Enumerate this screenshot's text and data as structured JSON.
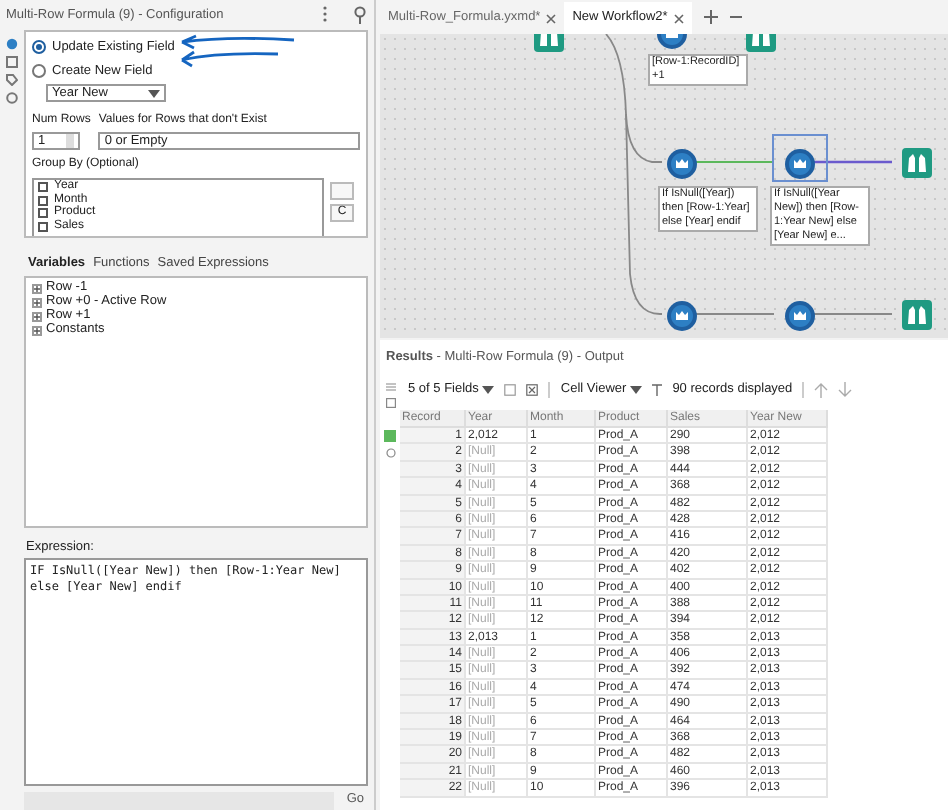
{
  "config": {
    "title": "Multi-Row Formula (9) - Configuration",
    "radios": [
      {
        "label": "Update Existing Field",
        "selected": true
      },
      {
        "label": "Create New  Field",
        "selected": false
      }
    ],
    "field_select": "Year New",
    "num_rows_label": "Num Rows",
    "num_rows": "1",
    "values_label": "Values for Rows that don't Exist",
    "values_select": "0 or Empty",
    "group_by_label": "Group By (Optional)",
    "group_by": [
      {
        "label": "Year",
        "checked": false
      },
      {
        "label": "Month",
        "checked": false
      },
      {
        "label": "Product",
        "checked": false
      },
      {
        "label": "Sales",
        "checked": false
      }
    ],
    "side_button": "C",
    "tabs": [
      {
        "label": "Variables",
        "selected": true
      },
      {
        "label": "Functions",
        "selected": false
      },
      {
        "label": "Saved Expressions",
        "selected": false
      }
    ],
    "variables": [
      {
        "label": "Row -1",
        "expanded": false
      },
      {
        "label": "Row +0 - Active Row",
        "expanded": false
      },
      {
        "label": "Row +1",
        "expanded": false
      },
      {
        "label": "Constants",
        "expanded": false
      }
    ],
    "expression_label": "Expression:",
    "expression": "IF IsNull([Year New]) then [Row-1:Year New] else [Year New] endif",
    "go_button": "Go"
  },
  "workflow_tabs": [
    {
      "label": "Multi-Row_Formula.yxmd*",
      "selected": false
    },
    {
      "label": "New Workflow2*",
      "selected": true
    }
  ],
  "canvas": {
    "annotations": [
      "[Row-1:RecordID] +1",
      "If IsNull([Year]) then [Row-1:Year] else [Year] endif",
      "If IsNull([Year New]) then [Row-1:Year New] else [Year New] e..."
    ]
  },
  "results": {
    "title": "Results",
    "subtitle": " - Multi-Row Formula (9) - Output",
    "fields": "5 of 5 Fields",
    "viewer": "Cell Viewer",
    "records": "90 records displayed",
    "columns": [
      "Record",
      "Year",
      "Month",
      "Product",
      "Sales",
      "Year New"
    ],
    "rows": [
      {
        "cells": [
          "1",
          "2,012",
          "1",
          "Prod_A",
          "290",
          "2,012"
        ],
        "year_null": false
      },
      {
        "cells": [
          "2",
          "[Null]",
          "2",
          "Prod_A",
          "398",
          "2,012"
        ],
        "year_null": true
      },
      {
        "cells": [
          "3",
          "[Null]",
          "3",
          "Prod_A",
          "444",
          "2,012"
        ],
        "year_null": true
      },
      {
        "cells": [
          "4",
          "[Null]",
          "4",
          "Prod_A",
          "368",
          "2,012"
        ],
        "year_null": true
      },
      {
        "cells": [
          "5",
          "[Null]",
          "5",
          "Prod_A",
          "482",
          "2,012"
        ],
        "year_null": true
      },
      {
        "cells": [
          "6",
          "[Null]",
          "6",
          "Prod_A",
          "428",
          "2,012"
        ],
        "year_null": true
      },
      {
        "cells": [
          "7",
          "[Null]",
          "7",
          "Prod_A",
          "416",
          "2,012"
        ],
        "year_null": true
      },
      {
        "cells": [
          "8",
          "[Null]",
          "8",
          "Prod_A",
          "420",
          "2,012"
        ],
        "year_null": true
      },
      {
        "cells": [
          "9",
          "[Null]",
          "9",
          "Prod_A",
          "402",
          "2,012"
        ],
        "year_null": true
      },
      {
        "cells": [
          "10",
          "[Null]",
          "10",
          "Prod_A",
          "400",
          "2,012"
        ],
        "year_null": true
      },
      {
        "cells": [
          "11",
          "[Null]",
          "11",
          "Prod_A",
          "388",
          "2,012"
        ],
        "year_null": true
      },
      {
        "cells": [
          "12",
          "[Null]",
          "12",
          "Prod_A",
          "394",
          "2,012"
        ],
        "year_null": true
      },
      {
        "cells": [
          "13",
          "2,013",
          "1",
          "Prod_A",
          "358",
          "2,013"
        ],
        "year_null": false
      },
      {
        "cells": [
          "14",
          "[Null]",
          "2",
          "Prod_A",
          "406",
          "2,013"
        ],
        "year_null": true
      },
      {
        "cells": [
          "15",
          "[Null]",
          "3",
          "Prod_A",
          "392",
          "2,013"
        ],
        "year_null": true
      },
      {
        "cells": [
          "16",
          "[Null]",
          "4",
          "Prod_A",
          "474",
          "2,013"
        ],
        "year_null": true
      },
      {
        "cells": [
          "17",
          "[Null]",
          "5",
          "Prod_A",
          "490",
          "2,013"
        ],
        "year_null": true
      },
      {
        "cells": [
          "18",
          "[Null]",
          "6",
          "Prod_A",
          "464",
          "2,013"
        ],
        "year_null": true
      },
      {
        "cells": [
          "19",
          "[Null]",
          "7",
          "Prod_A",
          "368",
          "2,013"
        ],
        "year_null": true
      },
      {
        "cells": [
          "20",
          "[Null]",
          "8",
          "Prod_A",
          "482",
          "2,013"
        ],
        "year_null": true
      },
      {
        "cells": [
          "21",
          "[Null]",
          "9",
          "Prod_A",
          "460",
          "2,013"
        ],
        "year_null": true
      },
      {
        "cells": [
          "22",
          "[Null]",
          "10",
          "Prod_A",
          "396",
          "2,013"
        ],
        "year_null": true
      }
    ]
  }
}
